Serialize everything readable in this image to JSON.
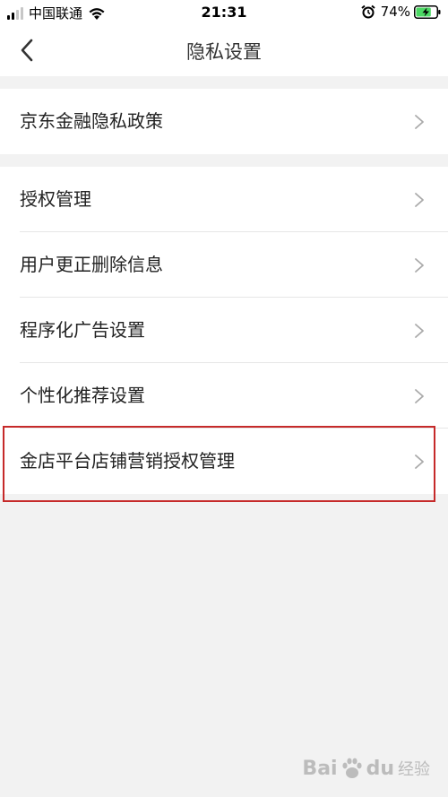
{
  "status_bar": {
    "carrier": "中国联通",
    "time": "21:31",
    "battery_percent": "74%",
    "battery_level": 0.74,
    "signal_bars_filled": 2,
    "signal_bars_total": 4
  },
  "nav": {
    "title": "隐私设置",
    "back_icon": "chevron-left-icon"
  },
  "sections": [
    {
      "items": [
        {
          "label": "京东金融隐私政策"
        }
      ]
    },
    {
      "items": [
        {
          "label": "授权管理"
        },
        {
          "label": "用户更正删除信息"
        },
        {
          "label": "程序化广告设置"
        },
        {
          "label": "个性化推荐设置"
        },
        {
          "label": "金店平台店铺营销授权管理"
        }
      ]
    }
  ],
  "highlight": {
    "color": "#c62a2a",
    "target": "金店平台店铺营销授权管理"
  },
  "watermark": {
    "brand": "Bai",
    "brand_suffix": "du",
    "sub": "经验"
  },
  "colors": {
    "background": "#f2f2f2",
    "card": "#ffffff",
    "chevron": "#aaaaaa",
    "battery_fill": "#4cd964"
  }
}
